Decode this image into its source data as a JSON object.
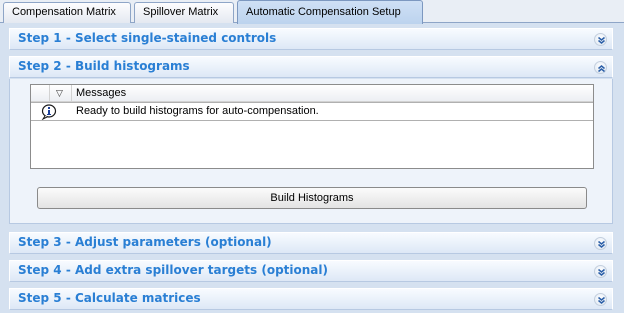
{
  "tabs": [
    {
      "label": "Compensation Matrix"
    },
    {
      "label": "Spillover Matrix"
    },
    {
      "label": "Automatic Compensation Setup"
    }
  ],
  "steps": [
    {
      "title": "Step 1 - Select single-stained controls",
      "expanded": false
    },
    {
      "title": "Step 2 - Build histograms",
      "expanded": true
    },
    {
      "title": "Step 3 - Adjust parameters (optional)",
      "expanded": false
    },
    {
      "title": "Step 4 - Add extra spillover targets (optional)",
      "expanded": false
    },
    {
      "title": "Step 5 - Calculate matrices",
      "expanded": false
    }
  ],
  "messages": {
    "column_header": "Messages",
    "rows": [
      {
        "icon": "info-icon",
        "text": "Ready to build histograms for auto-compensation."
      }
    ]
  },
  "build_button_label": "Build Histograms",
  "colors": {
    "step_title": "#2a7fd4",
    "panel_bg": "#d5e1f0",
    "active_tab": "#bcd3ee"
  }
}
